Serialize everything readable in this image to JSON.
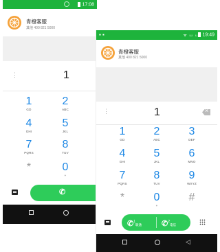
{
  "back_screen": {
    "status": {
      "time": "17:08"
    },
    "contact": {
      "name": "青橙客服",
      "number": "其他 400 821 5000"
    },
    "dial_input": "1",
    "menu_glyph": "⋮",
    "keys": [
      {
        "num": "1",
        "letters": "GD"
      },
      {
        "num": "2",
        "letters": "ABC"
      },
      {
        "num": "4",
        "letters": "GHI"
      },
      {
        "num": "5",
        "letters": "JKL"
      },
      {
        "num": "7",
        "letters": "PQRS"
      },
      {
        "num": "8",
        "letters": "TUV"
      },
      {
        "num": "*",
        "letters": ""
      },
      {
        "num": "0",
        "letters": "+"
      }
    ],
    "call_glyph": "✆"
  },
  "front_screen": {
    "status": {
      "time": "19:49",
      "signal": "ᯤ ₗᵢₗ ₗᵢₗ",
      "left_icons": "▪ ▪"
    },
    "contact": {
      "name": "青橙客服",
      "number": "其他 400 821 5000"
    },
    "dial_input": "1",
    "menu_glyph": "⋮",
    "keys": [
      {
        "num": "1",
        "letters": "GD"
      },
      {
        "num": "2",
        "letters": "ABC"
      },
      {
        "num": "3",
        "letters": "DEF"
      },
      {
        "num": "4",
        "letters": "GHI"
      },
      {
        "num": "5",
        "letters": "JKL"
      },
      {
        "num": "6",
        "letters": "MNO"
      },
      {
        "num": "7",
        "letters": "PQRS"
      },
      {
        "num": "8",
        "letters": "TUV"
      },
      {
        "num": "9",
        "letters": "WXYZ"
      },
      {
        "num": "*",
        "letters": ""
      },
      {
        "num": "0",
        "letters": "+"
      },
      {
        "num": "#",
        "letters": ""
      }
    ],
    "sim1": {
      "glyph": "✆",
      "slot": "1",
      "operator": "联通"
    },
    "sim2": {
      "glyph": "✆",
      "slot": "2",
      "operator": "电信"
    }
  },
  "nav": {
    "back": "◁"
  },
  "colors": {
    "accent_green": "#1eb33c",
    "call_green": "#2ecc5a",
    "key_blue": "#1e88e5",
    "avatar_orange": "#f5a23a"
  }
}
